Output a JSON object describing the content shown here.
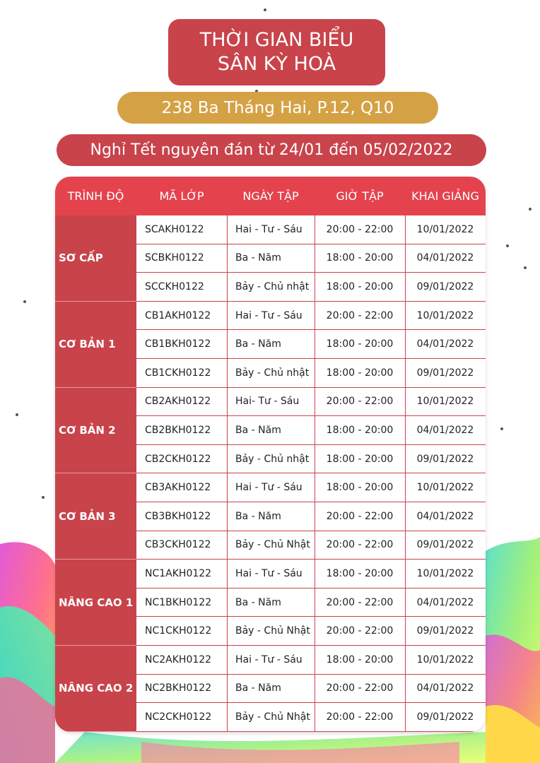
{
  "header": {
    "title_line1": "THỜI GIAN BIỂU",
    "title_line2": "SÂN KỲ HOÀ",
    "address": "238 Ba Tháng Hai, P.12, Q10",
    "notice": "Nghỉ Tết nguyên đán từ 24/01 đến 05/02/2022"
  },
  "colors": {
    "red": "#c9434b",
    "header_red": "#e4434d",
    "gold": "#d4a245"
  },
  "table": {
    "columns": [
      "TRÌNH ĐỘ",
      "MÃ LỚP",
      "NGÀY TẬP",
      "GIỜ TẬP",
      "KHAI GIẢNG"
    ],
    "levels": [
      {
        "name": "SƠ CẤP",
        "rows": [
          {
            "code": "SCAKH0122",
            "days": "Hai - Tư - Sáu",
            "time": "20:00 - 22:00",
            "start": "10/01/2022"
          },
          {
            "code": "SCBKH0122",
            "days": "Ba - Năm",
            "time": "18:00 - 20:00",
            "start": "04/01/2022"
          },
          {
            "code": "SCCKH0122",
            "days": "Bảy - Chủ nhật",
            "time": "18:00 - 20:00",
            "start": "09/01/2022"
          }
        ]
      },
      {
        "name": "CƠ BẢN 1",
        "rows": [
          {
            "code": "CB1AKH0122",
            "days": "Hai - Tư - Sáu",
            "time": "20:00 - 22:00",
            "start": "10/01/2022"
          },
          {
            "code": "CB1BKH0122",
            "days": "Ba - Năm",
            "time": "18:00 - 20:00",
            "start": "04/01/2022"
          },
          {
            "code": "CB1CKH0122",
            "days": "Bảy - Chủ nhật",
            "time": "18:00 - 20:00",
            "start": "09/01/2022"
          }
        ]
      },
      {
        "name": "CƠ BẢN 2",
        "rows": [
          {
            "code": "CB2AKH0122",
            "days": "Hai- Tư - Sáu",
            "time": "20:00 - 22:00",
            "start": "10/01/2022"
          },
          {
            "code": "CB2BKH0122",
            "days": "Ba - Năm",
            "time": "18:00 - 20:00",
            "start": "04/01/2022"
          },
          {
            "code": "CB2CKH0122",
            "days": "Bảy - Chủ nhật",
            "time": "18:00 - 20:00",
            "start": "09/01/2022"
          }
        ]
      },
      {
        "name": "CƠ BẢN 3",
        "rows": [
          {
            "code": "CB3AKH0122",
            "days": "Hai - Tư - Sáu",
            "time": "18:00 - 20:00",
            "start": "10/01/2022"
          },
          {
            "code": "CB3BKH0122",
            "days": "Ba - Năm",
            "time": "20:00 - 22:00",
            "start": "04/01/2022"
          },
          {
            "code": "CB3CKH0122",
            "days": "Bảy - Chủ Nhật",
            "time": "20:00 - 22:00",
            "start": "09/01/2022"
          }
        ]
      },
      {
        "name": "NÂNG CAO 1",
        "rows": [
          {
            "code": "NC1AKH0122",
            "days": "Hai - Tư - Sáu",
            "time": "18:00 - 20:00",
            "start": "10/01/2022"
          },
          {
            "code": "NC1BKH0122",
            "days": "Ba - Năm",
            "time": "20:00 - 22:00",
            "start": "04/01/2022"
          },
          {
            "code": "NC1CKH0122",
            "days": "Bảy - Chủ Nhật",
            "time": "20:00 - 22:00",
            "start": "09/01/2022"
          }
        ]
      },
      {
        "name": "NÂNG CAO 2",
        "rows": [
          {
            "code": "NC2AKH0122",
            "days": "Hai - Tư - Sáu",
            "time": "18:00 - 20:00",
            "start": "10/01/2022"
          },
          {
            "code": "NC2BKH0122",
            "days": "Ba - Năm",
            "time": "20:00 - 22:00",
            "start": "04/01/2022"
          },
          {
            "code": "NC2CKH0122",
            "days": "Bảy - Chủ Nhật",
            "time": "20:00 - 22:00",
            "start": "09/01/2022"
          }
        ]
      }
    ]
  }
}
